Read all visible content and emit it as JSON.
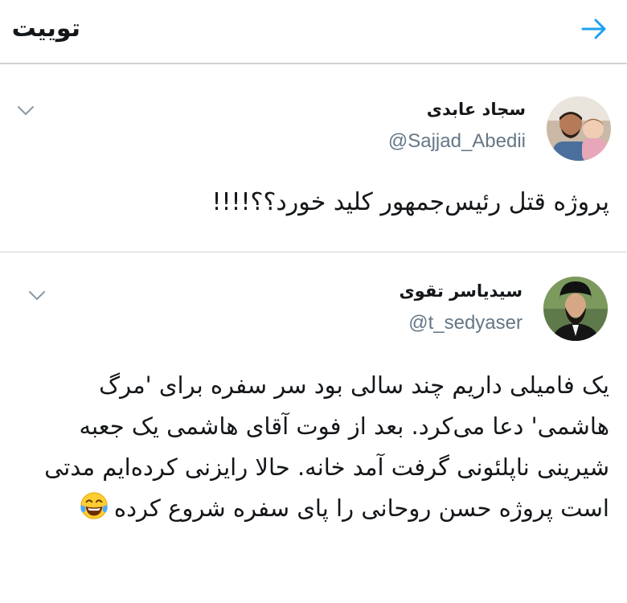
{
  "header": {
    "title": "توییت",
    "back_icon": "arrow-right-icon"
  },
  "colors": {
    "accent": "#1da1f2",
    "secondary_text": "#657786",
    "divider": "#cfd3d6"
  },
  "tweets": [
    {
      "display_name": "سجاد عابدی",
      "handle": "@Sajjad_Abedii",
      "text": "پروژه قتل رئیس‌جمهور کلید خورد؟؟!!!!",
      "menu_icon": "chevron-down-icon"
    },
    {
      "display_name": "سیدیاسر تقوی",
      "handle": "@t_sedyaser",
      "text": "یک فامیلی داریم چند سالی بود سر سفره برای 'مرگ هاشمی' دعا می‌کرد. بعد از فوت آقای هاشمی یک جعبه شیرینی ناپلئونی گرفت آمد خانه. حالا رایزنی کرده‌ایم مدتی است پروژه حسن روحانی را پای سفره شروع کرده",
      "emoji_icon": "laughing-tears-emoji-icon",
      "menu_icon": "chevron-down-icon"
    }
  ]
}
